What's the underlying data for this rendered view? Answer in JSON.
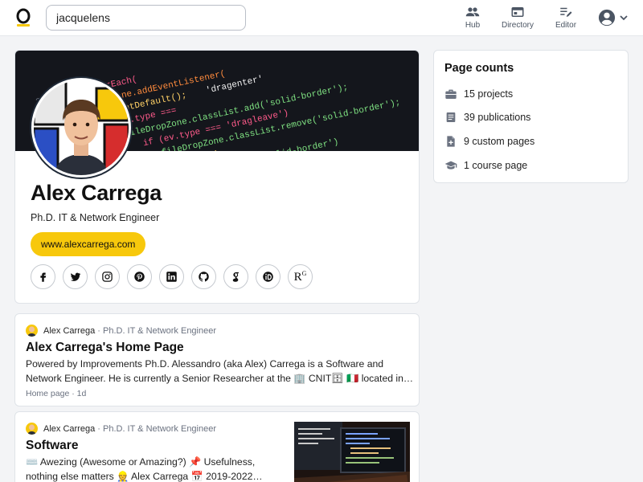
{
  "search": {
    "value": "jacquelens"
  },
  "nav": {
    "hub": "Hub",
    "directory": "Directory",
    "editor": "Editor"
  },
  "profile": {
    "name": "Alex Carrega",
    "role": "Ph.D. IT & Network Engineer",
    "website": "www.alexcarrega.com",
    "socials": [
      "facebook-icon",
      "twitter-icon",
      "instagram-icon",
      "pinterest-icon",
      "linkedin-icon",
      "github-icon",
      "google-scholar-icon",
      "orcid-icon",
      "researchgate-icon"
    ],
    "researchgate_glyph": "R",
    "researchgate_sup": "G"
  },
  "page_counts": {
    "title": "Page counts",
    "items": [
      {
        "icon": "briefcase-icon",
        "label": "15 projects"
      },
      {
        "icon": "document-icon",
        "label": "39 publications"
      },
      {
        "icon": "file-plus-icon",
        "label": "9 custom pages"
      },
      {
        "icon": "graduation-cap-icon",
        "label": "1 course page"
      }
    ]
  },
  "posts": [
    {
      "author": "Alex Carrega",
      "role": "· Ph.D. IT & Network Engineer",
      "title": "Alex Carrega's Home Page",
      "excerpt_line1": "Powered by Improvements Ph.D. Alessandro (aka Alex) Carrega is a Software and",
      "excerpt_line2": "Network Engineer. He is currently a Senior Researcher at the 🏢 CNIT🗄 🇮🇹 located in…",
      "meta": "Home page · 1d"
    },
    {
      "author": "Alex Carrega",
      "role": "· Ph.D. IT & Network Engineer",
      "title": "Software",
      "excerpt_line1": "⌨️ Awezing (Awesome or Amazing?) 📌 Usefulness,",
      "excerpt_line2": "nothing else matters 👷 Alex Carrega 📅 2019-2022…"
    }
  ],
  "colors": {
    "accent": "#f7c80c",
    "cover_bg": "#14161c"
  }
}
